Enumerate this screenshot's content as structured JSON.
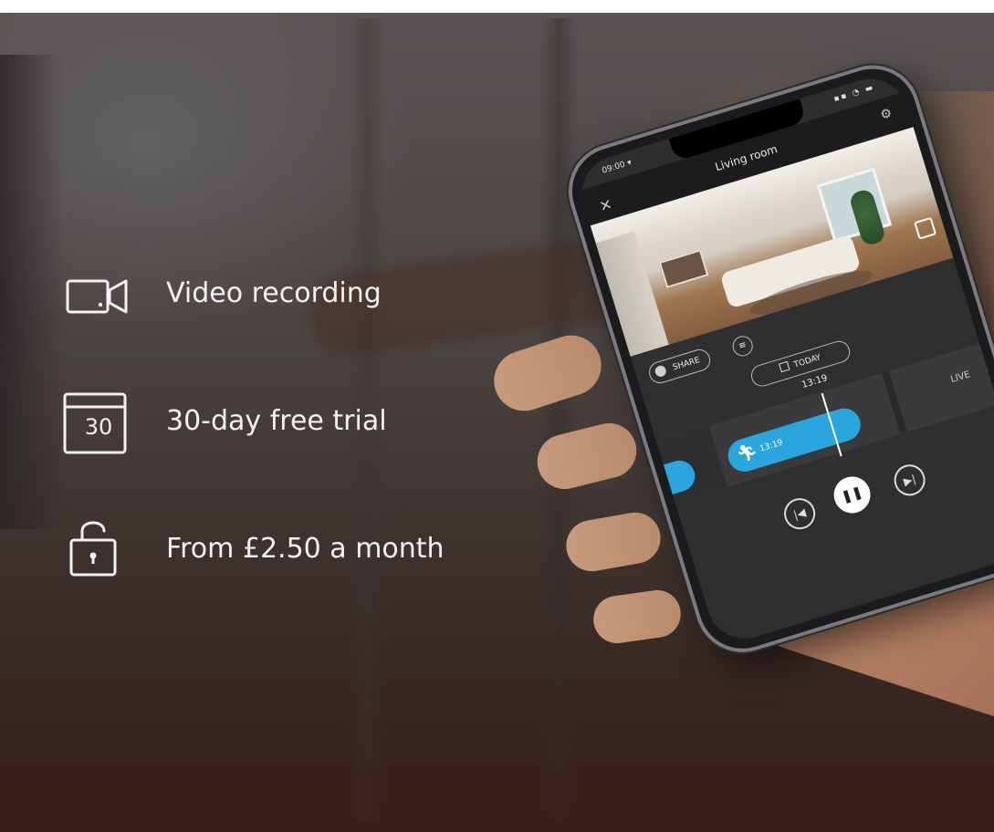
{
  "features": [
    {
      "label": "Video recording",
      "icon": "video-camera-icon"
    },
    {
      "label": "30-day free trial",
      "icon": "calendar-icon",
      "calendar_number": "30"
    },
    {
      "label": "From £2.50 a month",
      "icon": "unlocked-padlock-icon"
    }
  ],
  "phone": {
    "status_time": "09:00 ▾",
    "status_icons": "▪▪ ◔ ▬",
    "title": "Living room",
    "share_label": "SHARE",
    "date_label": "TODAY",
    "current_time": "13:19",
    "event_time": "13:19",
    "live_label": "LIVE",
    "accent_color": "#2aa5dd"
  }
}
